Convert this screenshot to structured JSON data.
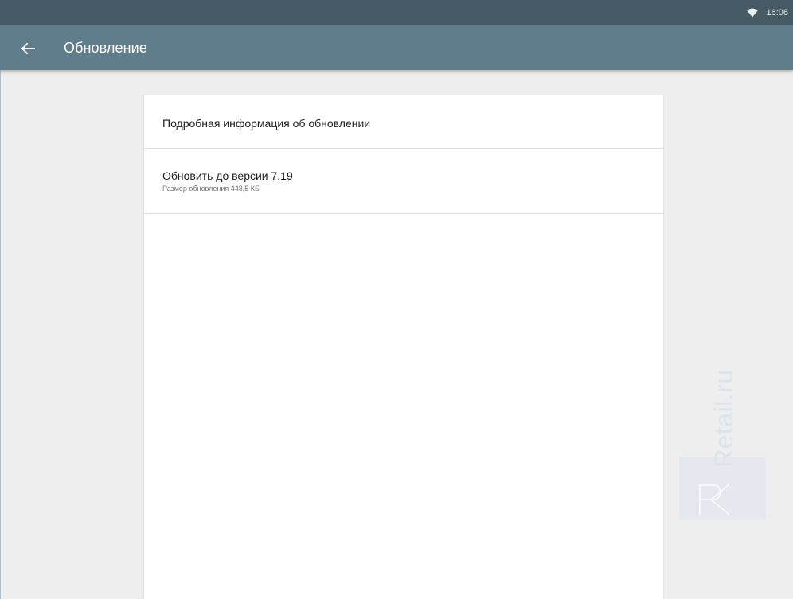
{
  "status_bar": {
    "time": "16:06",
    "wifi_icon": "wifi-icon"
  },
  "app_bar": {
    "back_icon": "arrow-back-icon",
    "title": "Обновление"
  },
  "update_list": {
    "details_label": "Подробная информация об обновлении",
    "update_title": "Обновить до версии 7.19",
    "update_size": "Размер обновления 448,5 КБ"
  },
  "watermark": {
    "text": "Retail.ru"
  },
  "colors": {
    "status_bar": "#455a64",
    "app_bar": "#607d8b",
    "background": "#eeeeee",
    "card": "#ffffff"
  }
}
